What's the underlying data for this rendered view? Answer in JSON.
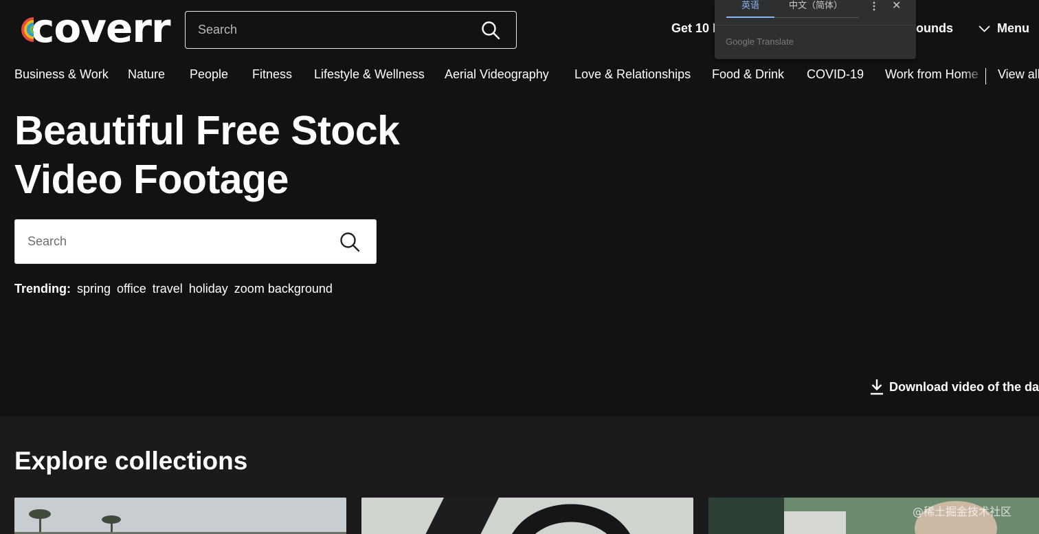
{
  "header": {
    "logo_text": "coverr",
    "search_placeholder": "Search",
    "link_partial_left": "Get 10 F",
    "link_partial_right": "ounds",
    "menu_label": "Menu"
  },
  "translate_popup": {
    "tab_source": "英语",
    "tab_target": "中文（简体）",
    "close_label": "✕",
    "brand": "Google Translate"
  },
  "nav": {
    "items": [
      "Business & Work",
      "Nature",
      "People",
      "Fitness",
      "Lifestyle & Wellness",
      "Aerial Videography",
      "Love & Relationships",
      "Food & Drink",
      "COVID-19",
      "Work from Home"
    ],
    "view_all": "View all"
  },
  "hero": {
    "title_line1": "Beautiful Free Stock",
    "title_line2": "Video Footage",
    "search_placeholder": "Search",
    "trending_label": "Trending:",
    "trending_tags": [
      "spring",
      "office",
      "travel",
      "holiday",
      "zoom background"
    ],
    "download_label": "Download video of the day"
  },
  "collections": {
    "title": "Explore collections"
  },
  "watermark": "@稀土掘金技术社区",
  "colors": {
    "background": "#121212",
    "section_background": "#1b1b1b",
    "logo_stripes": [
      "#e94b3c",
      "#f6b817",
      "#29a3dc",
      "#6fbf4a"
    ]
  }
}
